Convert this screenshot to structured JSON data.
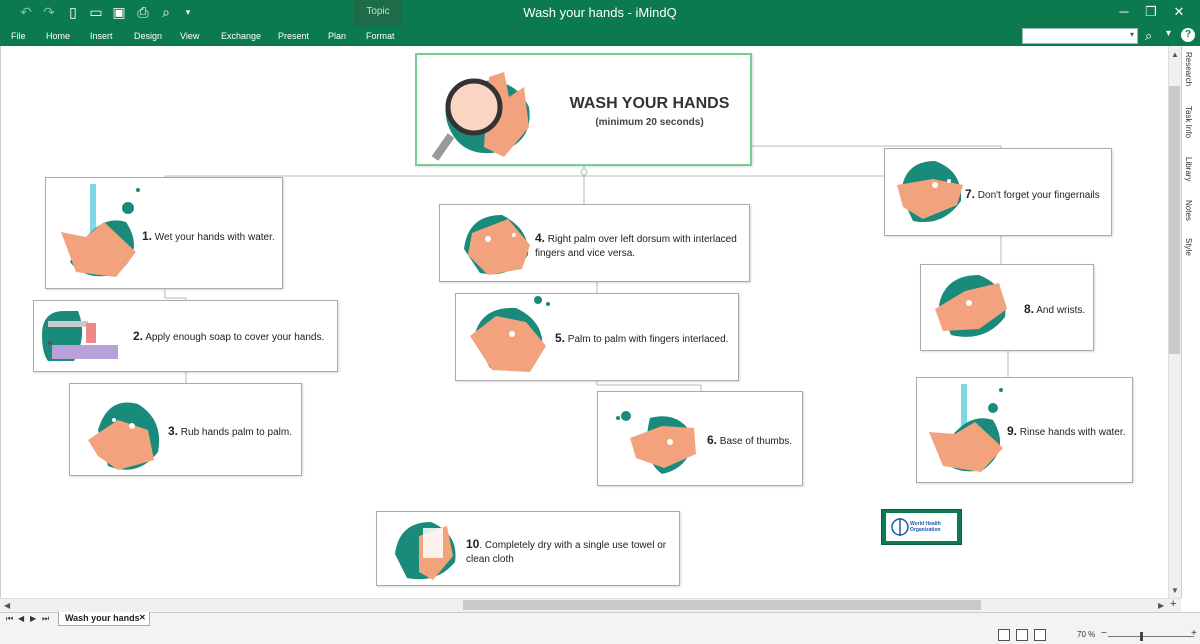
{
  "window": {
    "title": "Wash your hands - iMindQ",
    "context_tab": "Topic"
  },
  "ribbon": {
    "tabs": [
      "File",
      "Home",
      "Insert",
      "Design",
      "View",
      "Exchange",
      "Present",
      "Plan",
      "Format"
    ],
    "active_tab": "Format"
  },
  "quick_access": [
    "undo-icon",
    "redo-icon",
    "new-icon",
    "open-icon",
    "save-icon",
    "print-icon",
    "print-preview-icon",
    "customize-icon"
  ],
  "side_panel": [
    "Research",
    "Task Info",
    "Library",
    "Notes",
    "Style"
  ],
  "map": {
    "central": {
      "title": "WASH YOUR HANDS",
      "subtitle": "(minimum 20 seconds)"
    },
    "steps": [
      {
        "num": "1.",
        "text": "Wet your hands with water."
      },
      {
        "num": "2.",
        "text": "Apply enough soap to cover your hands."
      },
      {
        "num": "3.",
        "text": "Rub hands palm to palm."
      },
      {
        "num": "4.",
        "text": "Right palm over left dorsum with interlaced fingers and vice versa."
      },
      {
        "num": "5.",
        "text": "Palm to palm with fingers interlaced."
      },
      {
        "num": "6.",
        "text": "Base of thumbs."
      },
      {
        "num": "7.",
        "text": "Don't forget your fingernails"
      },
      {
        "num": "8.",
        "text": "And wrists."
      },
      {
        "num": "9.",
        "text": "Rinse hands with water."
      },
      {
        "num": "10",
        "text": ". Completely  dry with a single use towel or clean cloth"
      }
    ],
    "logo": {
      "line1": "World Health",
      "line2": "Organization"
    }
  },
  "statusbar": {
    "sheet_tab": "Wash your hands",
    "zoom": "70 %"
  },
  "colors": {
    "brand": "#0b7a4e",
    "teal": "#1a8a7a",
    "skin": "#f2a27c"
  }
}
